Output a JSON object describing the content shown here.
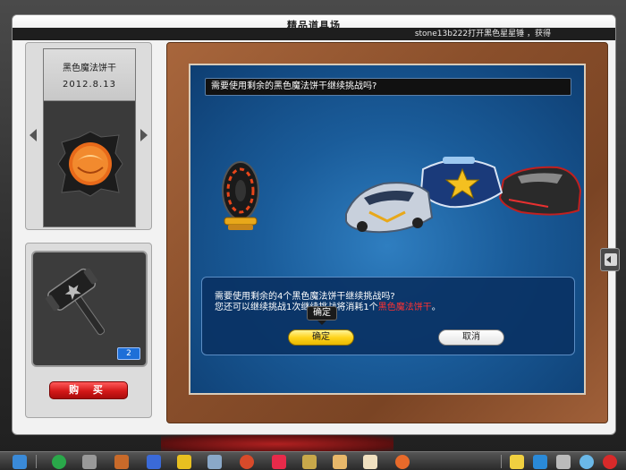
{
  "window": {
    "title": "精品道具场",
    "marquee": "stone13b222打开黑色星星锤 ，获得"
  },
  "item_panel": {
    "name": "黑色魔法饼干",
    "date": "2012.8.13",
    "icon": "fortune-cookie-icon"
  },
  "shop_panel": {
    "icon": "hammer-icon",
    "count": "2",
    "buy_label": "购 买"
  },
  "challenge": {
    "question": "需要使用剩余的黑色魔法饼干继续挑战吗?",
    "prize_icon": "tire-icon",
    "cars_icon": "race-cars-icon"
  },
  "dialog": {
    "line1": "需要使用剩余的4个黑色魔法饼干继续挑战吗?",
    "line2_before": "您还可以继续挑战1次继续挑战将消耗1个",
    "line2_highlight": "黑色魔法饼干",
    "line2_after": "。",
    "tooltip": "确定",
    "confirm_label": "确定",
    "cancel_label": "取消"
  },
  "colors": {
    "accent_red": "#d41818",
    "accent_yellow": "#ffd41c",
    "panel_blue": "#1a5c9a",
    "wood": "#8a4f2b"
  },
  "taskbar": {
    "icons": [
      "start-icon",
      "back-icon",
      "shop-cart-icon",
      "character-icon",
      "kart-icon",
      "spanner-icon",
      "gear-icon",
      "target-icon",
      "heart-icon",
      "sword-icon",
      "glove-icon",
      "book-icon",
      "bomb-icon",
      "notes-icon",
      "settings-icon",
      "tools-icon",
      "search-icon",
      "power-icon"
    ]
  }
}
